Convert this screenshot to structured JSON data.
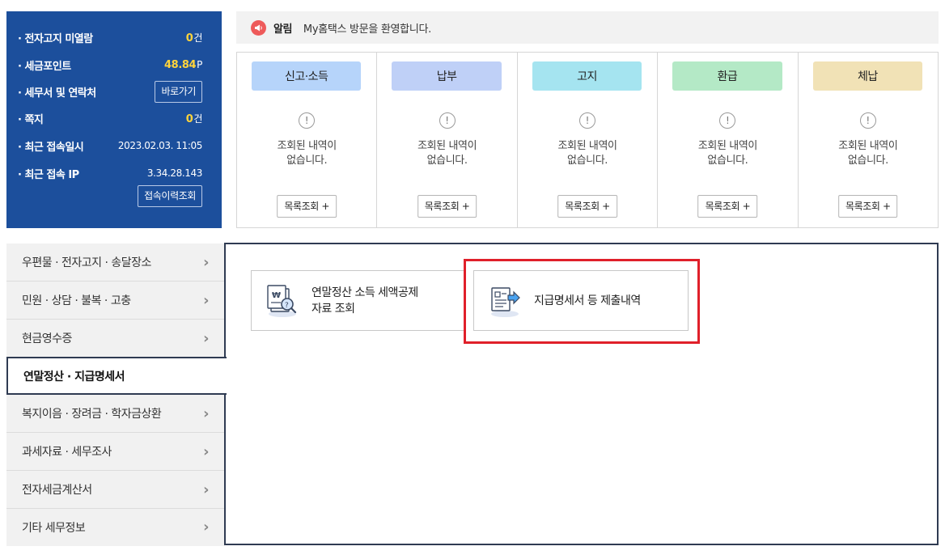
{
  "info_panel": {
    "unread_label": "전자고지 미열람",
    "unread_count": "0",
    "unread_unit": "건",
    "points_label": "세금포인트",
    "points_value": "48.84",
    "points_unit": "P",
    "office_label": "세무서 및 연락처",
    "office_button": "바로가기",
    "memo_label": "쪽지",
    "memo_count": "0",
    "memo_unit": "건",
    "last_login_label": "최근 접속일시",
    "last_login_value": "2023.02.03.  11:05",
    "last_ip_label": "최근 접속 IP",
    "last_ip_value": "3.34.28.143",
    "history_button": "접속이력조회",
    "colors": {
      "panel_bg": "#1c4f9c",
      "highlight_num": "#ffd43b"
    }
  },
  "notice": {
    "icon": "megaphone-icon",
    "title": "알림",
    "message": "My홈택스 방문을 환영합니다."
  },
  "cards": [
    {
      "title": "신고·소득",
      "color": "#b6d4fa",
      "alert_icon": "!",
      "empty_line1": "조회된 내역이",
      "empty_line2": "없습니다.",
      "button": "목록조회 +"
    },
    {
      "title": "납부",
      "color": "#bfd0f7",
      "alert_icon": "!",
      "empty_line1": "조회된 내역이",
      "empty_line2": "없습니다.",
      "button": "목록조회 +"
    },
    {
      "title": "고지",
      "color": "#a5e4f0",
      "alert_icon": "!",
      "empty_line1": "조회된 내역이",
      "empty_line2": "없습니다.",
      "button": "목록조회 +"
    },
    {
      "title": "환급",
      "color": "#b4e9c6",
      "alert_icon": "!",
      "empty_line1": "조회된 내역이",
      "empty_line2": "없습니다.",
      "button": "목록조회 +"
    },
    {
      "title": "체납",
      "color": "#f1e2b6",
      "alert_icon": "!",
      "empty_line1": "조회된 내역이",
      "empty_line2": "없습니다.",
      "button": "목록조회 +"
    }
  ],
  "menu": {
    "items": [
      {
        "label": "우편물 · 전자고지 · 송달장소",
        "active": false
      },
      {
        "label": "민원 · 상담 · 불복 · 고충",
        "active": false
      },
      {
        "label": "현금영수증",
        "active": false
      },
      {
        "label": "연말정산 · 지급명세서",
        "active": true
      },
      {
        "label": "복지이음 · 장려금 · 학자금상환",
        "active": false
      },
      {
        "label": "과세자료 · 세무조사",
        "active": false
      },
      {
        "label": "전자세금계산서",
        "active": false
      },
      {
        "label": "기타 세무정보",
        "active": false
      }
    ],
    "chevron": "›"
  },
  "content": {
    "services": [
      {
        "icon": "document-search-icon",
        "line1": "연말정산 소득 세액공제",
        "line2": "자료 조회"
      },
      {
        "icon": "document-submit-icon",
        "line1": "지급명세서 등 제출내역",
        "line2": ""
      }
    ],
    "highlight_color": "#e0202a"
  }
}
